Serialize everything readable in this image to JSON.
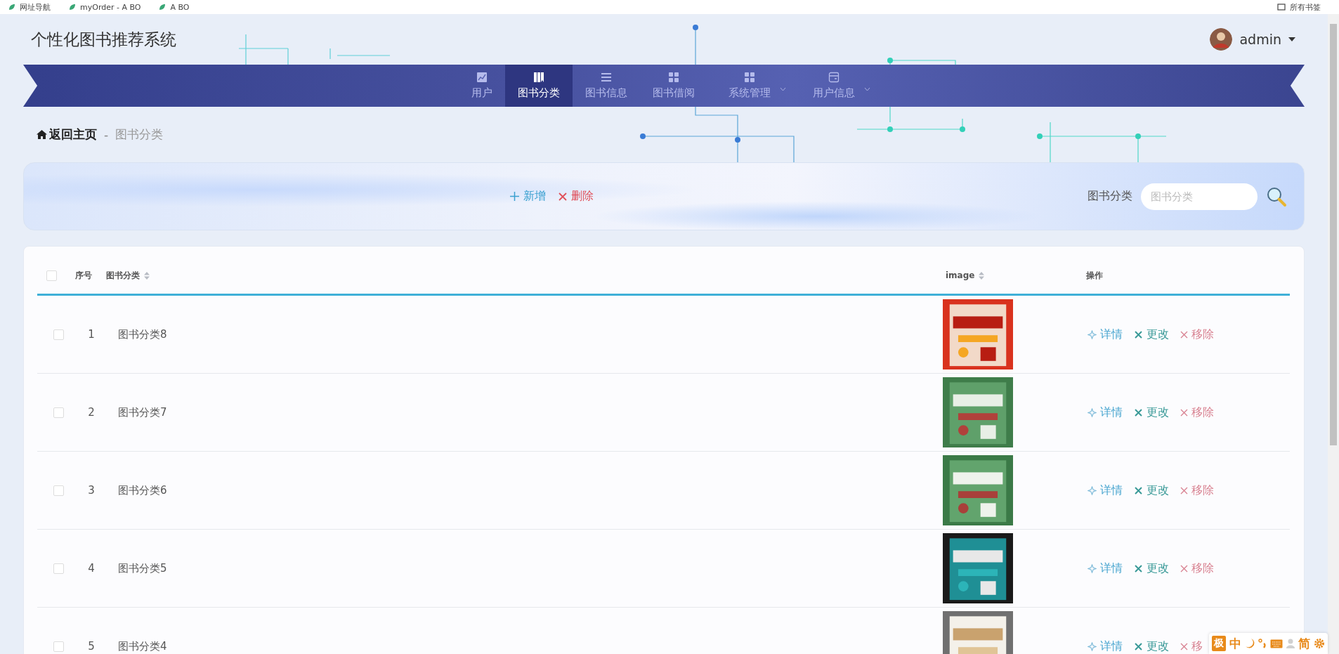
{
  "bookmarks": {
    "items": [
      "网址导航",
      "myOrder - A BO",
      "A BO"
    ],
    "all": "所有书签"
  },
  "header": {
    "title": "个性化图书推荐系统",
    "user": "admin"
  },
  "nav": [
    {
      "label": "用户",
      "selected": false,
      "dropdown": false
    },
    {
      "label": "图书分类",
      "selected": true,
      "dropdown": false
    },
    {
      "label": "图书信息",
      "selected": false,
      "dropdown": false
    },
    {
      "label": "图书借阅",
      "selected": false,
      "dropdown": false
    },
    {
      "label": "系统管理",
      "selected": false,
      "dropdown": true
    },
    {
      "label": "用户信息",
      "selected": false,
      "dropdown": true
    }
  ],
  "breadcrumb": {
    "home": "返回主页",
    "separator": "-",
    "current": "图书分类"
  },
  "toolbar": {
    "add": "新增",
    "delete": "删除",
    "search_label": "图书分类",
    "search": {
      "placeholder": "图书分类"
    }
  },
  "table": {
    "header_checked": false,
    "columns": [
      {
        "label": "序号",
        "sortable": false
      },
      {
        "label": "图书分类",
        "sortable": true
      },
      {
        "label": "image",
        "sortable": true
      },
      {
        "label": "操作",
        "sortable": false
      }
    ],
    "rows": [
      {
        "checked": false,
        "index": "1",
        "name": "图书分类8",
        "image": {
          "kind": "picture"
        },
        "actions": [
          {
            "kind": "detail",
            "label": "详情"
          },
          {
            "kind": "edit",
            "label": "更改"
          },
          {
            "kind": "remove",
            "label": "移除"
          }
        ]
      },
      {
        "checked": false,
        "index": "2",
        "name": "图书分类7",
        "image": {
          "kind": "picture"
        },
        "actions": [
          {
            "kind": "detail",
            "label": "详情"
          },
          {
            "kind": "edit",
            "label": "更改"
          },
          {
            "kind": "remove",
            "label": "移除"
          }
        ]
      },
      {
        "checked": false,
        "index": "3",
        "name": "图书分类6",
        "image": {
          "kind": "picture"
        },
        "actions": [
          {
            "kind": "detail",
            "label": "详情"
          },
          {
            "kind": "edit",
            "label": "更改"
          },
          {
            "kind": "remove",
            "label": "移除"
          }
        ]
      },
      {
        "checked": false,
        "index": "4",
        "name": "图书分类5",
        "image": {
          "kind": "picture"
        },
        "actions": [
          {
            "kind": "detail",
            "label": "详情"
          },
          {
            "kind": "edit",
            "label": "更改"
          },
          {
            "kind": "remove",
            "label": "移除"
          }
        ]
      },
      {
        "checked": false,
        "index": "5",
        "name": "图书分类4",
        "image": {
          "kind": "picture"
        },
        "actions": [
          {
            "kind": "detail",
            "label": "详情"
          },
          {
            "kind": "edit",
            "label": "更改"
          },
          {
            "kind": "remove",
            "label": "移"
          }
        ]
      }
    ]
  },
  "ime_toolbar": {
    "badge": "极",
    "mode": "中",
    "script": "简"
  }
}
